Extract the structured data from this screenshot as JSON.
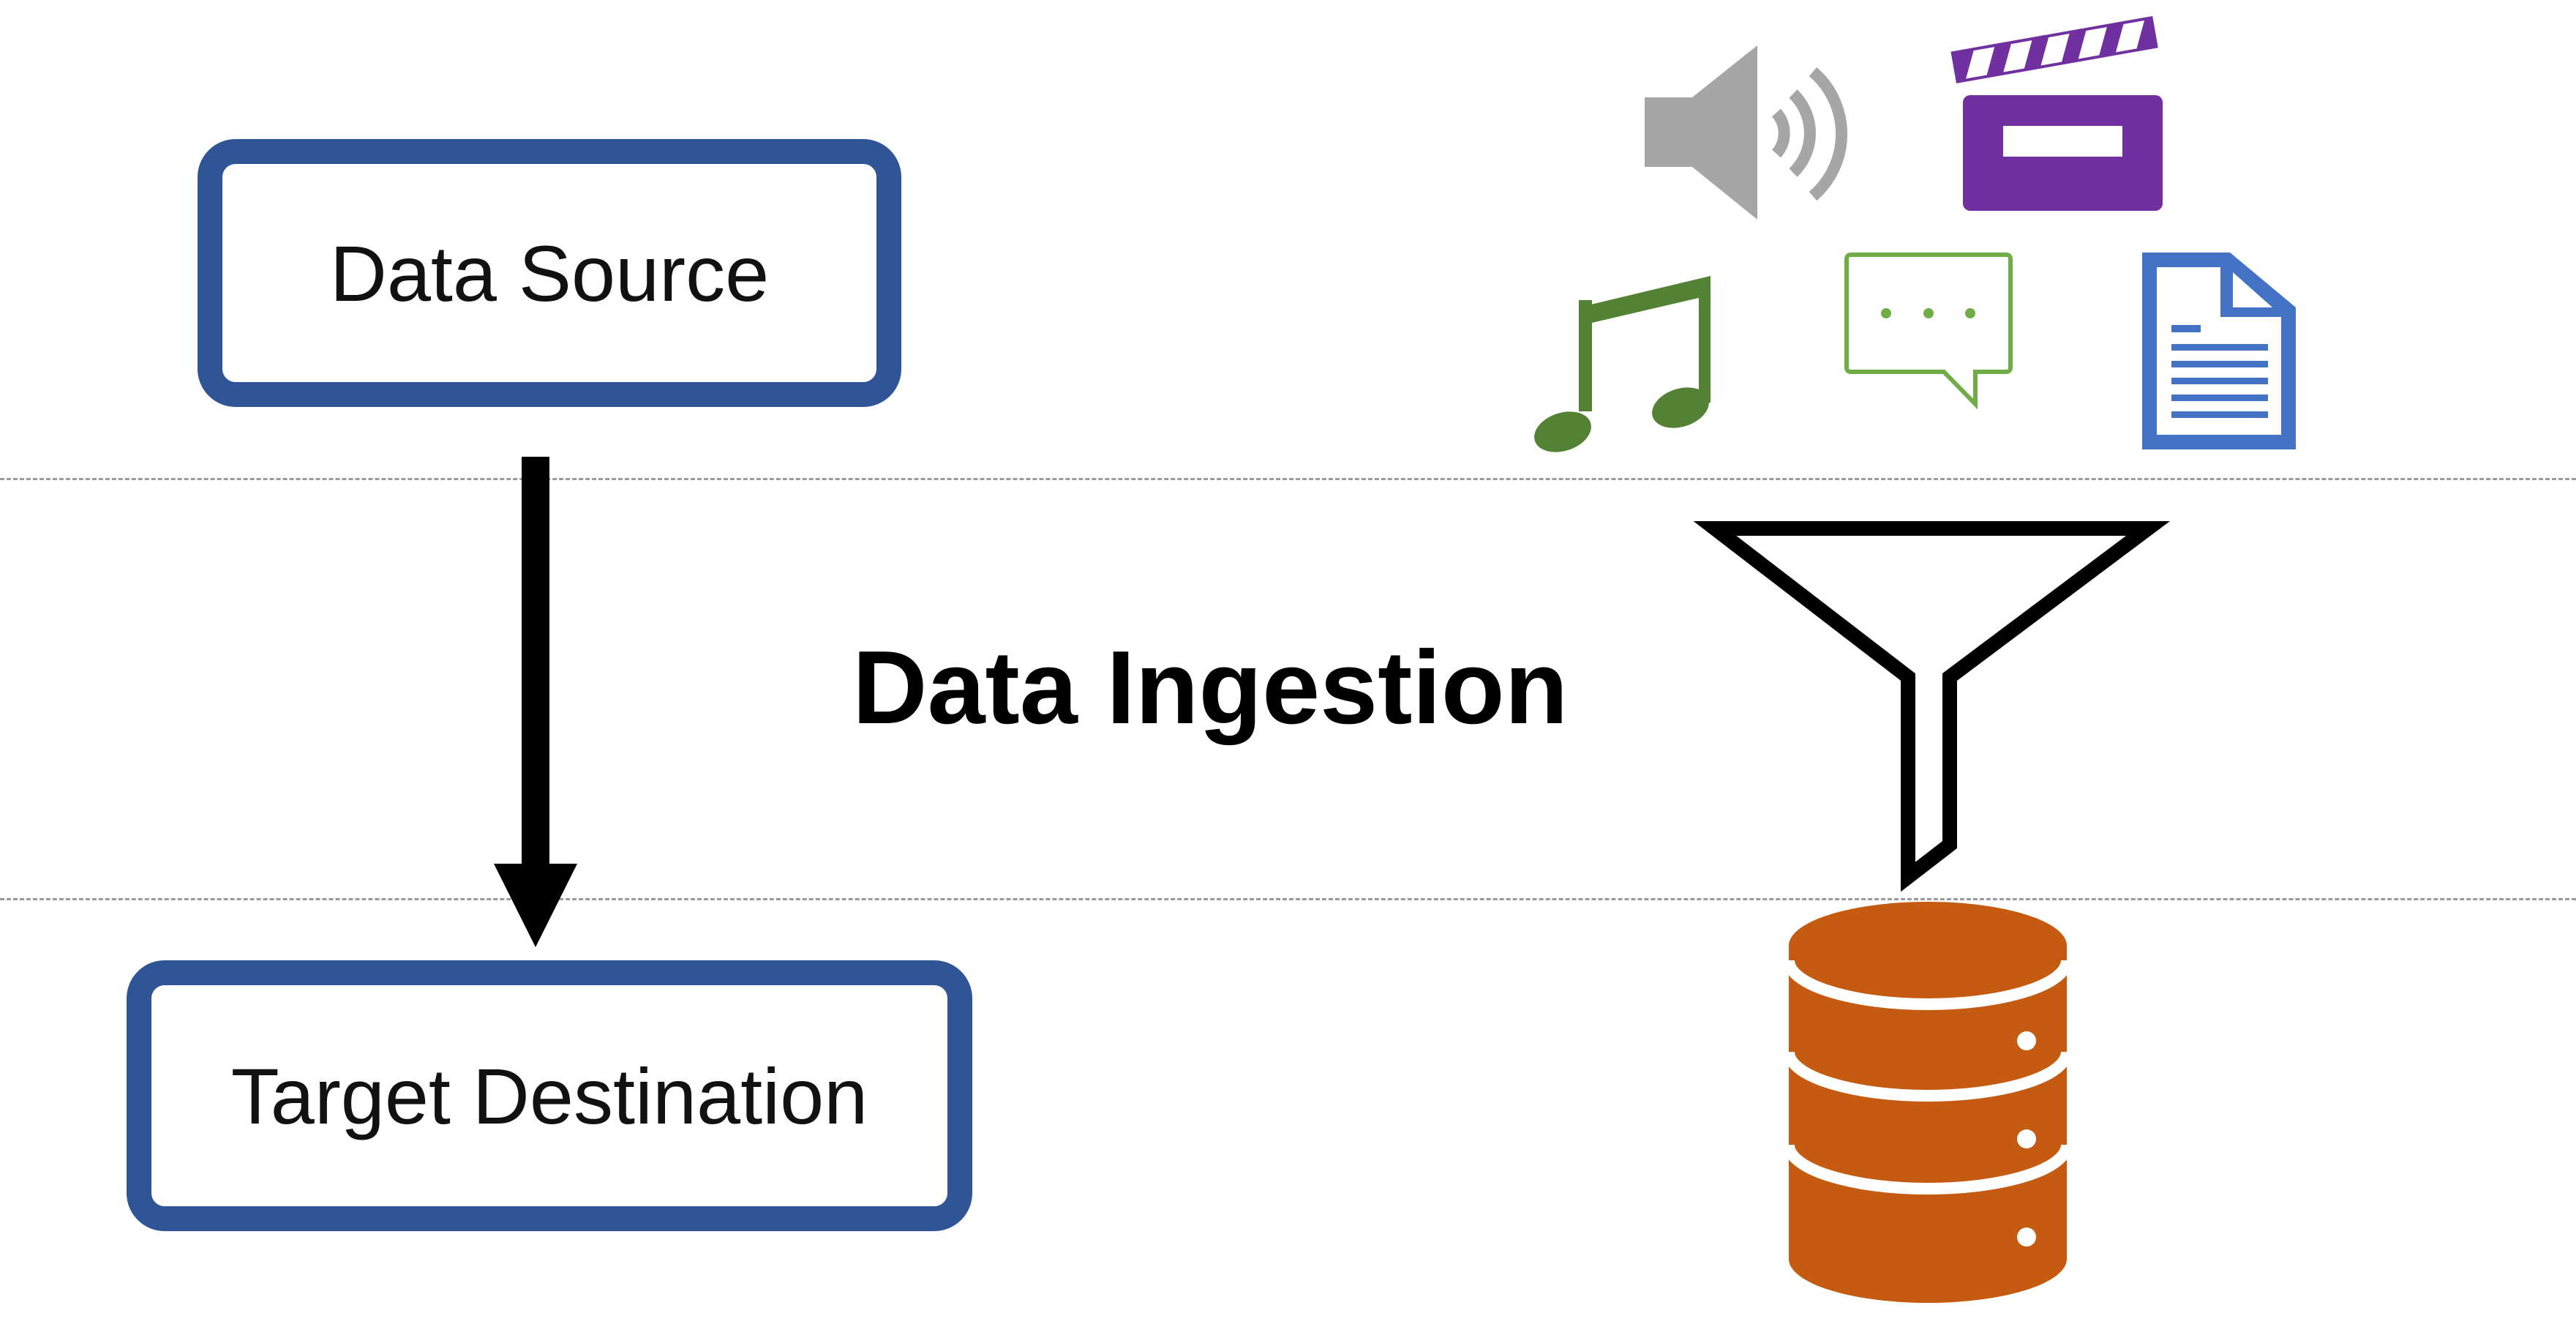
{
  "diagram": {
    "source_label": "Data Source",
    "target_label": "Target Destination",
    "center_title": "Data Ingestion"
  },
  "icons": {
    "top_row": [
      "speaker-icon",
      "clapperboard-icon"
    ],
    "bottom_row": [
      "music-note-icon",
      "chat-bubble-icon",
      "document-icon"
    ],
    "filter": "funnel-icon",
    "storage": "database-icon"
  },
  "colors": {
    "box_border": "#2F5597",
    "speaker": "#A6A6A6",
    "clapperboard": "#7030A0",
    "music_note": "#548235",
    "chat_bubble": "#70AD47",
    "document": "#4472C4",
    "database": "#C55A11",
    "arrow": "#000000"
  }
}
